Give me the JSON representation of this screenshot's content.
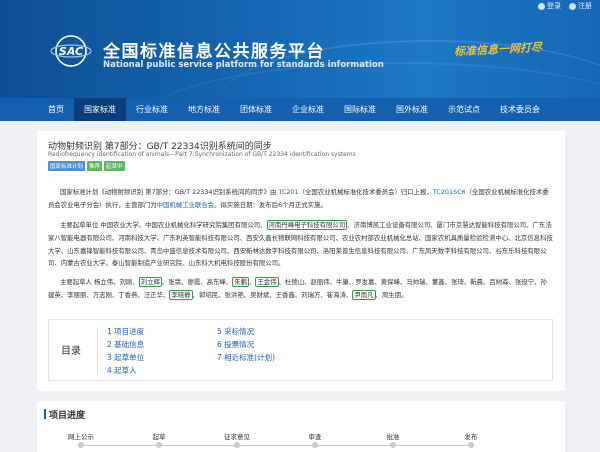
{
  "topbar": {
    "items": [
      {
        "label": "登录",
        "icon": "user-icon"
      },
      {
        "label": "注册",
        "icon": "edit-icon"
      }
    ]
  },
  "header": {
    "logo_text": "SAC",
    "title": "全国标准信息公共服务平台",
    "subtitle": "National public service platform  for standards information",
    "slogan": "标准信息一网打尽"
  },
  "nav": {
    "items": [
      "首页",
      "国家标准",
      "行业标准",
      "地方标准",
      "团体标准",
      "企业标准",
      "国际标准",
      "国外标准",
      "示范试点",
      "技术委员会"
    ],
    "active_index": 1
  },
  "standard": {
    "title": "动物射频识别 第7部分：GB/T 22334识别系统间的同步",
    "title_en": "Radiofrequency identification of animals—Part 7:Synchronization of GB/T 22334 identification systems",
    "tags": [
      {
        "label": "国家标准计划",
        "color": "#4f8fd1"
      },
      {
        "label": "推荐",
        "color": "#5cb85c"
      },
      {
        "label": "起草中",
        "color": "#5cb85c"
      }
    ]
  },
  "paragraphs": {
    "p1": {
      "s1": "国家标准计划《动物射频识别 第7部分：GB/T 22334识别系统间的同步》由 ",
      "l1": "TC201",
      "s2": "（全国农业机械标准化技术委员会）归口上报，",
      "l2": "TC201SC6",
      "s3": "（全国农业机械标准化技术委员会农业电子分会）执行，主管部门为",
      "l3": "中国机械工业联合会",
      "s4": "。拟实施日期：发布后6个月正式实施。"
    },
    "p2": {
      "s1": "主要起草单位 中国农业大学、中国农业机械化科学研究院集团有限公司、",
      "h1": "河南丹峰电子科技有限公司",
      "s2": "、济南博凯工业设备有限公司、厦门市京慧达智能科技有限公司、广东浩家八智能电器有限公司、河南科技大学、广东利英智能科技有限公司、西安久鑫长物联网科技有限公司、农业农村部农业机械化总站、国家农机具质量检验检测中心、北京信息科技大学、山东嘉锋智能科技有限公司、青岛中盛信息技术有限公司、西安新林达数字科技有限公司、洛阳莱普生信息科技有限公司、广东凤天数字科技有限公司、谷东乐科技有限公司、内蒙古农业大学、泰山智能制造产业研究院、山东科大机电科技股份有限公司。"
    },
    "p3": {
      "s1": "主要起草人 杨立伟、刘刚、",
      "h1": "刘立辉",
      "s2": "、张翡、廖霞、高东峰、",
      "h2": "朱鹏",
      "s3": "、",
      "h3": "王金伟",
      "s4": "、杜德山、赵丽伟、牛康、罗发嘉、黄保峰、马帅瑞、董鑫、张琦、靳晨、吕树森、张役宁、孙建英、李丽丽、方志刚、丁香燕、汪正华、",
      "h4": "李晓静",
      "s5": "、郭绍民、张洪艳、吴财斌、王香鑫、刘瑞方、崔海涛、",
      "h5": "尹雨凡",
      "s6": "、周生朋。"
    }
  },
  "toc": {
    "label": "目录",
    "col1": [
      "1  项目进度",
      "2  基础信息",
      "3  起草单位",
      "4  起草人"
    ],
    "col2": [
      "5  采标情况",
      "6  投票情况",
      "7  相近标准(计划)"
    ]
  },
  "progress": {
    "title": "项目进度",
    "steps": [
      "网上公示",
      "起草",
      "征求意见",
      "审查",
      "批准",
      "发布"
    ]
  },
  "colors": {
    "nav_bg": "#1560ae",
    "nav_active": "#0b3d7a",
    "link": "#1d62b5",
    "highlight": "#2e9e4a"
  }
}
